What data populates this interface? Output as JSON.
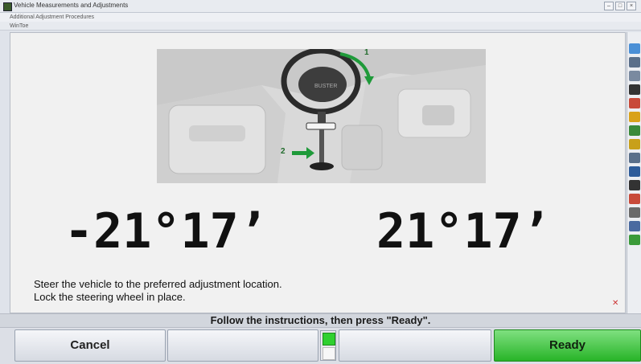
{
  "window": {
    "title": "Vehicle Measurements and Adjustments",
    "subtitle": "Additional Adjustment Procedures",
    "subtitle2": "WinToe",
    "controls": [
      "–",
      "□",
      "×"
    ]
  },
  "illustration": {
    "step1_label": "1",
    "step2_label": "2",
    "description": "Steering wheel with lock device installed"
  },
  "readings": {
    "left": "-21°17’",
    "right": "21°17’"
  },
  "instructions": {
    "line1": "Steer the vehicle to the preferred adjustment location.",
    "line2": "Lock the steering wheel in place."
  },
  "status": {
    "message": "Follow the instructions, then press \"Ready\"."
  },
  "buttons": {
    "cancel": "Cancel",
    "f2": "",
    "f3": "",
    "ready": "Ready"
  },
  "colors": {
    "ready_green": "#28b428",
    "level_green": "#2fd02f",
    "arrow_green": "#1f9a3a"
  },
  "sidebar_icons": [
    "help-icon",
    "tool-icon",
    "gauge-icon",
    "arc-icon",
    "camber-icon",
    "caster-icon",
    "toe-icon",
    "thrust-icon",
    "axle-icon",
    "wheel-icon",
    "rotate-icon",
    "lift-icon",
    "vehicle-icon",
    "print-icon",
    "exit-icon"
  ]
}
